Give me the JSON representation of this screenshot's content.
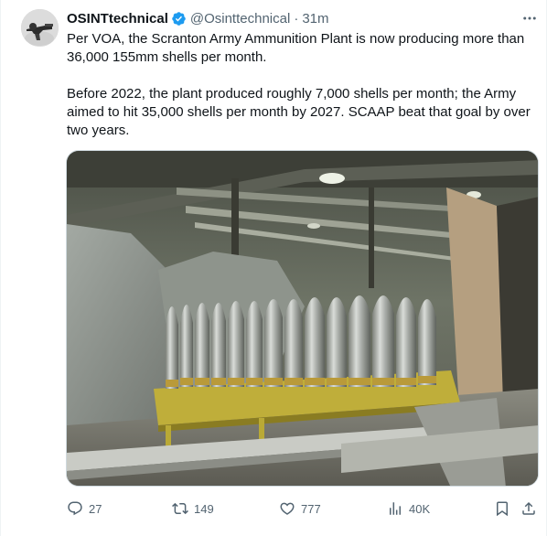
{
  "tweet": {
    "author": {
      "display_name": "OSINTtechnical",
      "handle": "@Osinttechnical",
      "verified": true,
      "time": "31m"
    },
    "text": [
      "Per VOA, the Scranton Army Ammunition Plant is now producing more than 36,000 155mm shells per month.",
      "Before 2022, the plant produced roughly 7,000 shells per month; the Army aimed to hit 35,000 shells per month by 2027. SCAAP beat that goal by over two years."
    ],
    "separator": "·",
    "stats": {
      "replies": "27",
      "reposts": "149",
      "likes": "777",
      "views": "40K"
    }
  },
  "colors": {
    "text_primary": "#0f1419",
    "text_secondary": "#536471",
    "verified": "#1d9bf0",
    "border": "#cfd9de"
  },
  "icons": {
    "verified": "verified-badge-icon",
    "more": "more-icon",
    "reply": "reply-icon",
    "repost": "repost-icon",
    "like": "like-icon",
    "views": "views-icon",
    "bookmark": "bookmark-icon",
    "share": "share-icon"
  }
}
